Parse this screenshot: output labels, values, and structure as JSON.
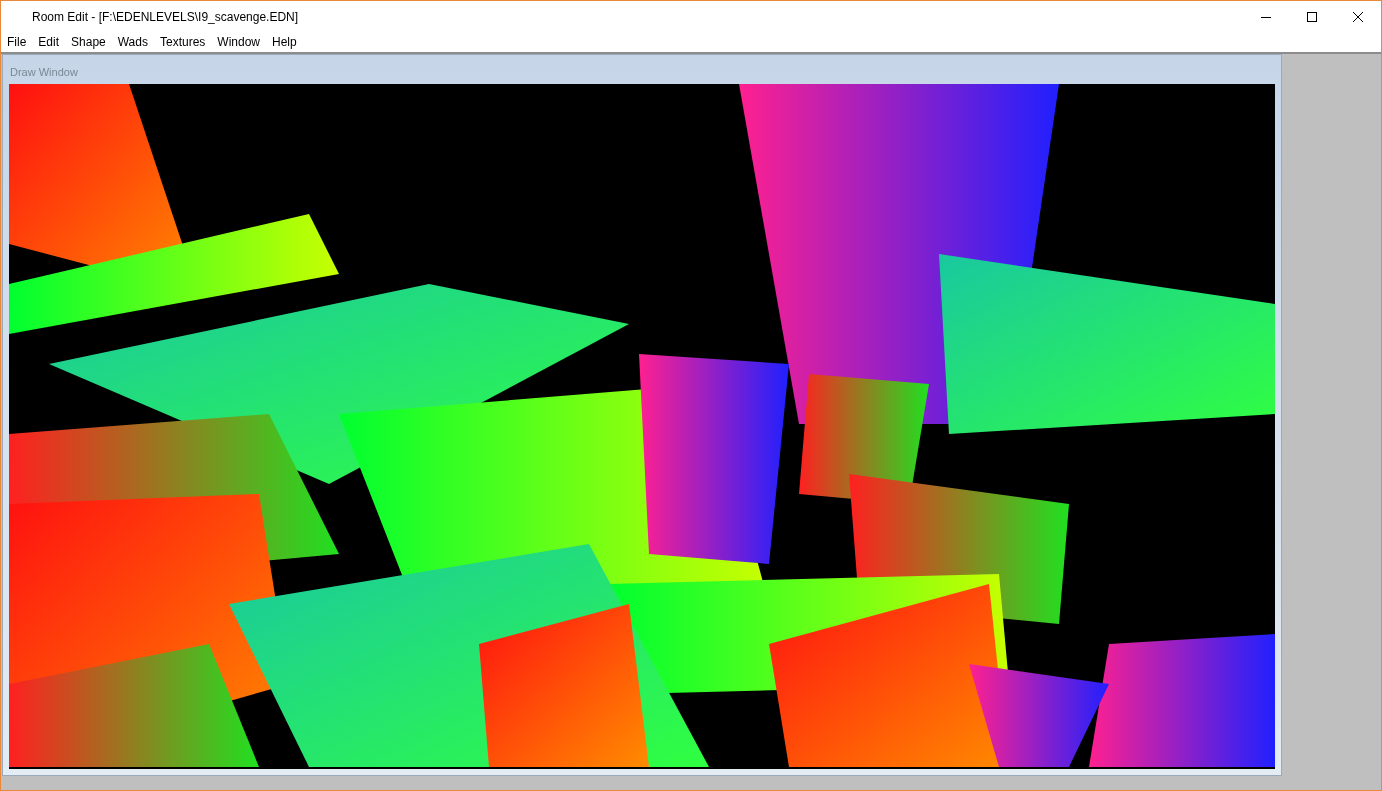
{
  "window": {
    "title": "Room Edit - [F:\\EDENLEVELS\\I9_scavenge.EDN]"
  },
  "menu": [
    "File",
    "Edit",
    "Shape",
    "Wads",
    "Textures",
    "Window",
    "Help"
  ],
  "child_window": {
    "title": "Draw Window"
  }
}
